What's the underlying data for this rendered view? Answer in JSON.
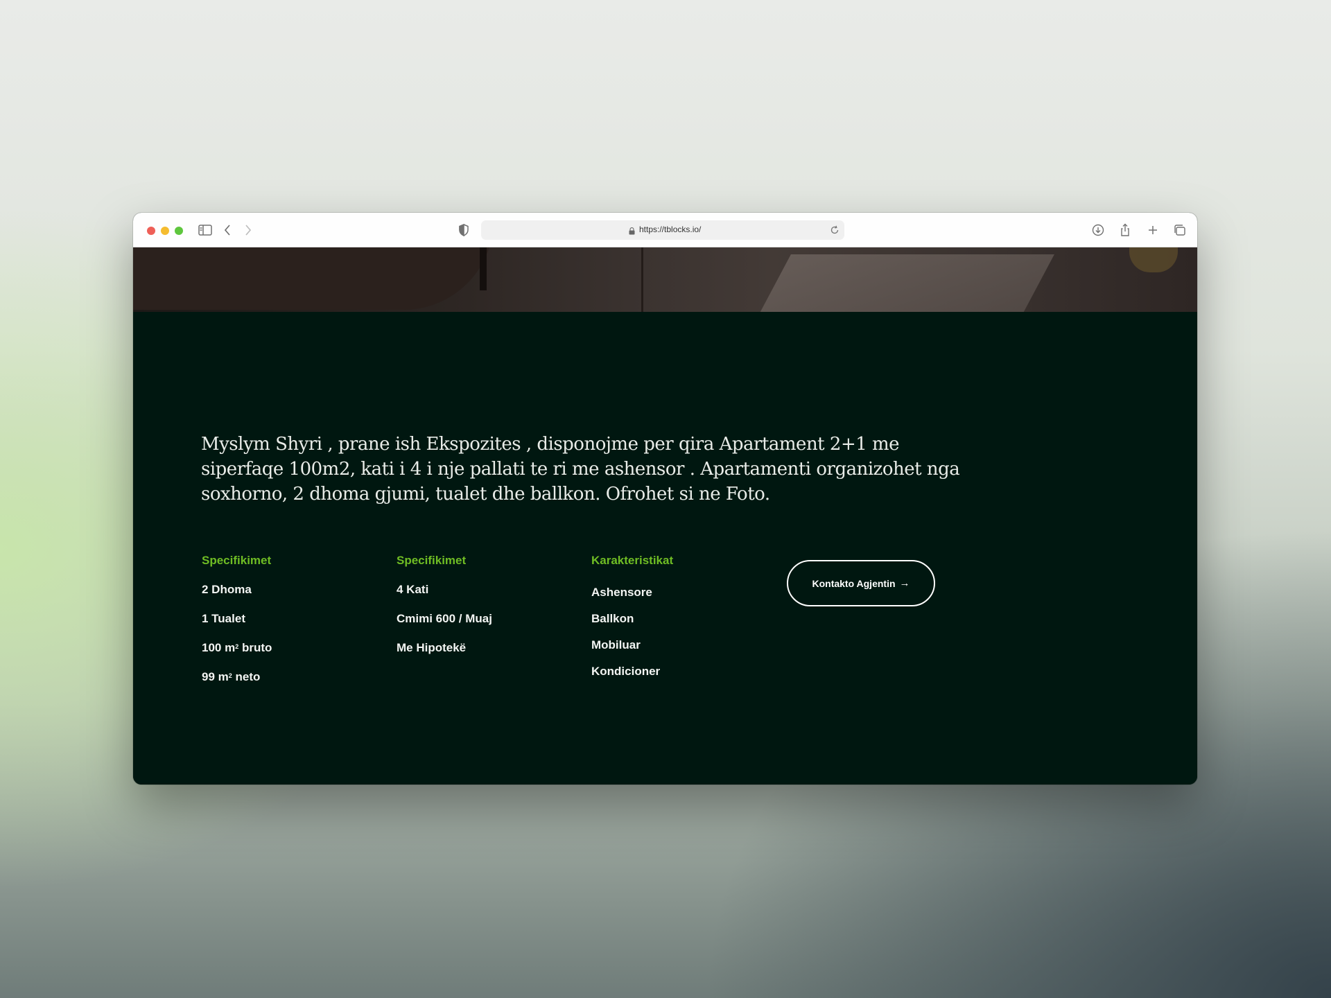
{
  "browser": {
    "url": "https://tblocks.io/",
    "icons": [
      "sidebar-icon",
      "back-icon",
      "forward-icon",
      "shield-icon",
      "lock-icon",
      "reload-icon",
      "download-icon",
      "share-icon",
      "new-tab-icon",
      "tabs-overview-icon"
    ]
  },
  "listing": {
    "description": "Myslym Shyri , prane ish Ekspozites , disponojme per qira Apartament 2+1 me siperfaqe 100m2, kati i 4 i nje pallati te ri me ashensor . Apartamenti organizohet nga soxhorno, 2 dhoma gjumi, tualet dhe ballkon. Ofrohet si ne Foto.",
    "columns": [
      {
        "heading": "Specifikimet",
        "items": [
          "2 Dhoma",
          "1 Tualet"
        ],
        "area": [
          {
            "value": "100 m",
            "sup": "2",
            "suffix": " bruto"
          },
          {
            "value": "99 m",
            "sup": "2",
            "suffix": " neto"
          }
        ]
      },
      {
        "heading": "Specifikimet",
        "items": [
          "4 Kati",
          "Cmimi 600 / Muaj",
          "Me Hipotekë"
        ]
      },
      {
        "heading": "Karakteristikat",
        "items": [
          "Ashensore",
          "Ballkon",
          "Mobiluar",
          "Kondicioner"
        ]
      }
    ],
    "cta": {
      "label": "Kontakto Agjentin",
      "arrow": "→"
    }
  },
  "colors": {
    "accent_green": "#6fbd24",
    "background": "#001710",
    "text": "#f3f5f3"
  }
}
